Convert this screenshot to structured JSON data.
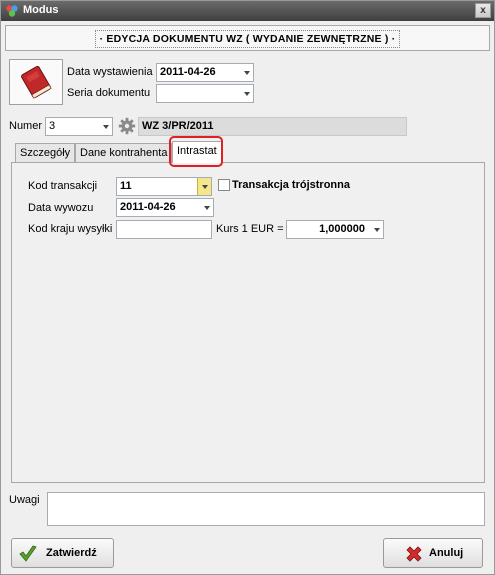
{
  "window": {
    "title": "Modus",
    "close_label": "x"
  },
  "header": {
    "title": "· EDYCJA DOKUMENTU WZ ( WYDANIE ZEWNĘTRZNE ) ·"
  },
  "document": {
    "issue_date_label": "Data wystawienia",
    "issue_date_value": "2011-04-26",
    "series_label": "Seria dokumentu",
    "series_value": "",
    "number_label": "Numer",
    "number_value": "3",
    "doc_number": "WZ 3/PR/2011"
  },
  "tabs": [
    {
      "label": "Szczegóły"
    },
    {
      "label": "Dane kontrahenta"
    },
    {
      "label": "Intrastat"
    }
  ],
  "intrastat": {
    "transaction_code_label": "Kod transakcji",
    "transaction_code_value": "11",
    "triangular_label": "Transakcja trójstronna",
    "export_date_label": "Data wywozu",
    "export_date_value": "2011-04-26",
    "country_code_label": "Kod kraju wysyłki",
    "country_code_value": "",
    "rate_label": "Kurs 1 EUR =",
    "rate_value": "1,000000"
  },
  "notes": {
    "label": "Uwagi",
    "value": ""
  },
  "buttons": {
    "confirm": "Zatwierdź",
    "cancel": "Anuluj"
  },
  "colors": {
    "highlight": "#e02020",
    "titlebar": "#4a4a4a",
    "book": "#c0282a"
  }
}
